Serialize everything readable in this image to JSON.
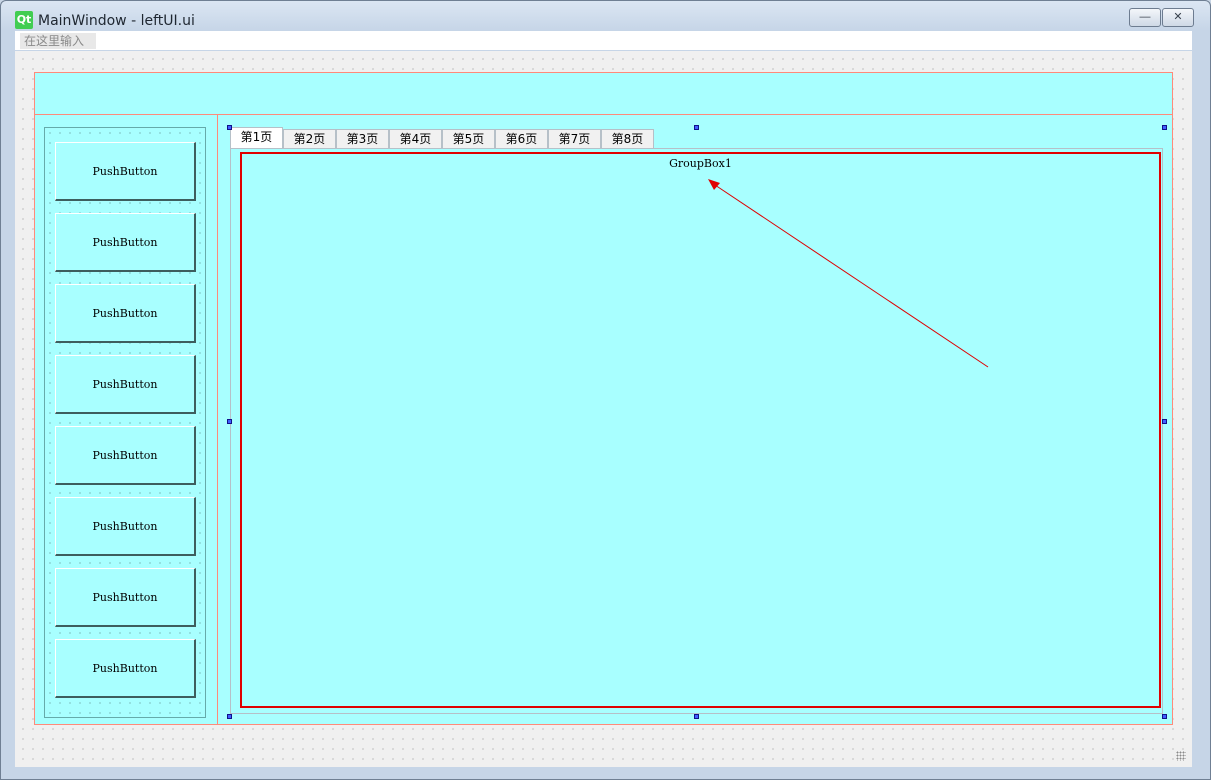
{
  "window": {
    "app_icon": "qt-logo-icon",
    "logo_text": "Qt",
    "title": "MainWindow - leftUI.ui",
    "minimize_glyph": "—",
    "close_glyph": "✕"
  },
  "menubar": {
    "placeholder_entry": "在这里输入"
  },
  "left_panel": {
    "buttons": [
      "PushButton",
      "PushButton",
      "PushButton",
      "PushButton",
      "PushButton",
      "PushButton",
      "PushButton",
      "PushButton"
    ]
  },
  "tabs": {
    "items": [
      "第1页",
      "第2页",
      "第3页",
      "第4页",
      "第5页",
      "第6页",
      "第7页",
      "第8页"
    ],
    "active_index": 0
  },
  "group_box": {
    "title": "GroupBox1"
  },
  "colors": {
    "widget_background": "#a8ffff",
    "layout_border": "#ff8a7a",
    "groupbox_border": "#e00000",
    "annotation_arrow": "#e00000",
    "selection_handle": "#3f5fff"
  }
}
